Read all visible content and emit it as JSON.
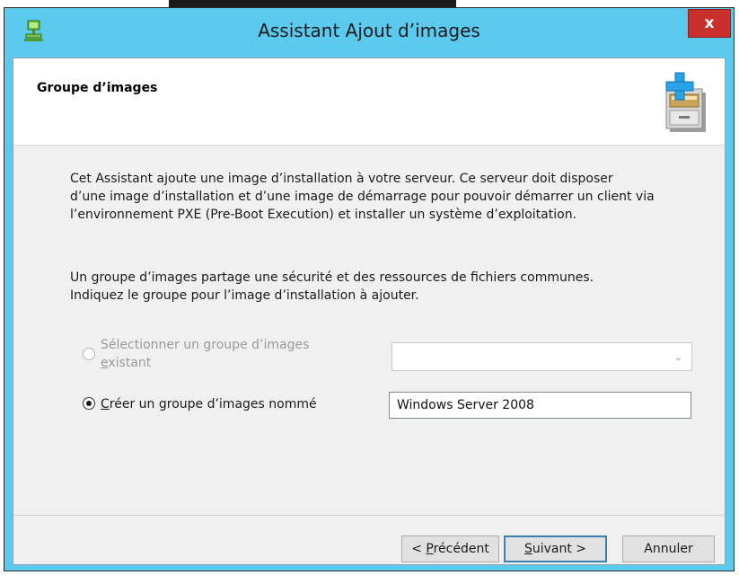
{
  "window": {
    "title": "Assistant Ajout d’images",
    "close_label": "x"
  },
  "header": {
    "title": "Groupe d’images",
    "icon": "image-cabinet-add-icon"
  },
  "intro": {
    "lines": [
      "Cet Assistant ajoute une image d’installation à votre serveur. Ce serveur doit disposer",
      "d’une image d’installation et d’une image de démarrage pour pouvoir démarrer un client via",
      "l’environnement PXE (Pre-Boot Execution) et installer un système d’exploitation."
    ]
  },
  "group_text": {
    "lines": [
      "Un groupe d’images partage une sécurité et des ressources de fichiers communes.",
      "Indiquez le groupe pour l’image d’installation à ajouter."
    ]
  },
  "options": {
    "existing": {
      "label_line1": "Sélectionner un groupe d’images",
      "label_line2_accel": "e",
      "label_line2_rest": "xistant",
      "enabled": false,
      "selected": false,
      "combo_value": ""
    },
    "create": {
      "label_accel": "C",
      "label_rest": "réer un groupe d’images nommé",
      "selected": true,
      "value": "Windows Server 2008"
    }
  },
  "buttons": {
    "prev_prefix": "< ",
    "prev_accel": "P",
    "prev_rest": "récédent",
    "next_accel": "S",
    "next_rest": "uivant >",
    "cancel": "Annuler"
  },
  "colors": {
    "titlebar": "#5cc9ef",
    "close": "#c9302c",
    "client_bg": "#f0f0f0",
    "accent_border": "#3c7fb1"
  }
}
